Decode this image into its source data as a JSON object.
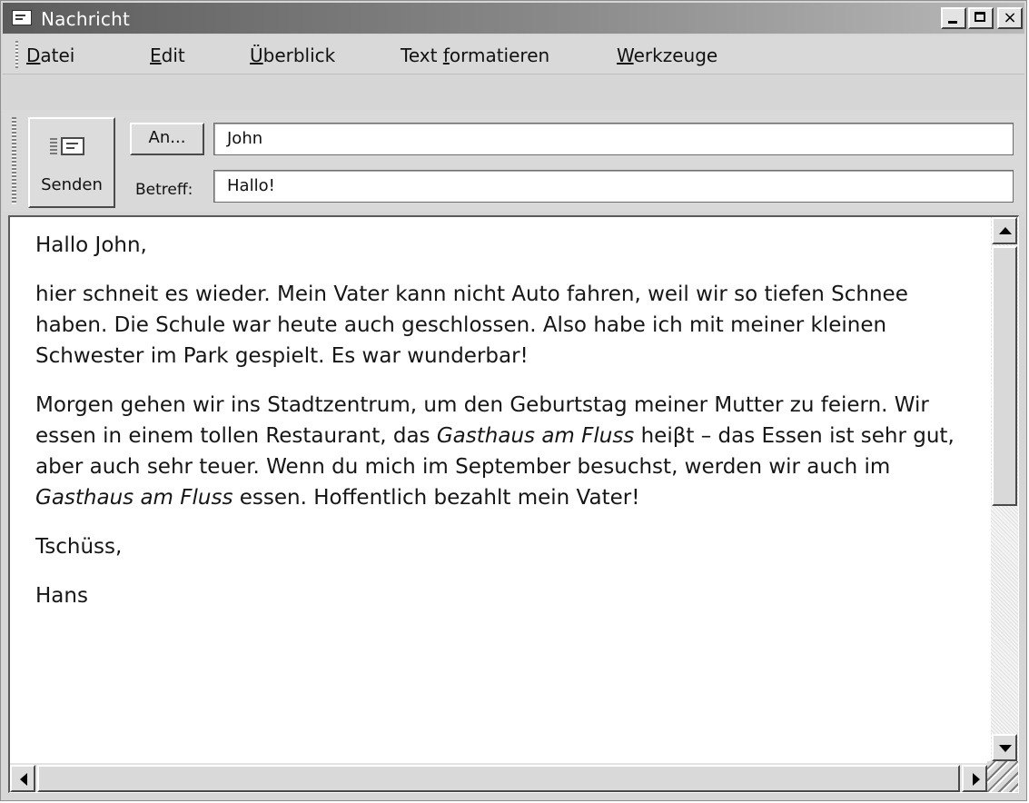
{
  "window": {
    "title": "Nachricht",
    "icon": "message-icon",
    "controls": {
      "minimize": "minimize-icon",
      "maximize": "maximize-icon",
      "close_glyph": "×"
    }
  },
  "menu": [
    {
      "prefix": "",
      "mnemonic": "D",
      "rest": "atei"
    },
    {
      "prefix": "",
      "mnemonic": "E",
      "rest": "dit"
    },
    {
      "prefix": "",
      "mnemonic": "Ü",
      "rest": "berblick"
    },
    {
      "prefix": "Text ",
      "mnemonic": "f",
      "rest": "ormatieren"
    },
    {
      "prefix": "",
      "mnemonic": "W",
      "rest": "erkzeuge"
    }
  ],
  "compose": {
    "send_label": "Senden",
    "to_button": "An...",
    "to_value": "John",
    "subject_label": "Betreff:",
    "subject_value": "Hallo!"
  },
  "message": {
    "greeting": "Hallo John,",
    "p1": "hier schneit es wieder. Mein Vater kann nicht Auto fahren, weil wir so tiefen Schnee haben. Die Schule war heute auch geschlossen. Also habe ich mit meiner kleinen Schwester im Park gespielt. Es war wunderbar!",
    "p2_a": "Morgen gehen wir ins Stadtzentrum, um den Geburtstag meiner Mutter zu feiern. Wir essen in einem tollen Restaurant, das ",
    "p2_em1": "Gasthaus am Fluss",
    "p2_b": " heiβt – das Essen ist sehr gut, aber auch sehr teuer. Wenn du mich im September besuchst, werden wir auch im ",
    "p2_em2": "Gasthaus am Fluss",
    "p2_c": " essen. Hoffentlich bezahlt mein Vater!",
    "closing": "Tschüss,",
    "signature": "Hans"
  },
  "colors": {
    "titlebar_dark": "#5c5c5c",
    "titlebar_light": "#b9b9b9",
    "chrome": "#d9d9d9"
  }
}
